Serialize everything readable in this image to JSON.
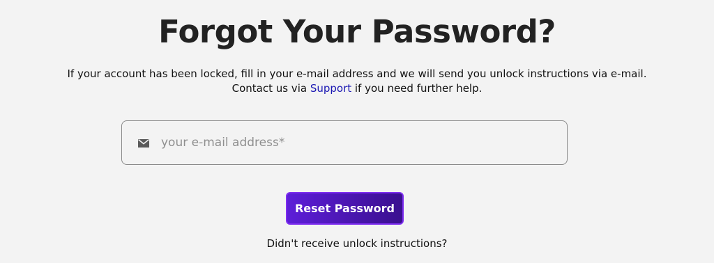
{
  "header": {
    "title": "Forgot Your Password?"
  },
  "description": {
    "line1": "If your account has been locked, fill in your e-mail address and we will send you unlock instructions via e-mail.",
    "line2_prefix": "Contact us via ",
    "support_link": "Support",
    "line2_suffix": " if you need further help."
  },
  "form": {
    "email": {
      "icon": "envelope-icon",
      "placeholder": "your e-mail address*",
      "value": ""
    },
    "submit_label": "Reset Password",
    "resend_link": "Didn't receive unlock instructions?"
  },
  "colors": {
    "background": "#f3f3f3",
    "link": "#1a17b3",
    "button_start": "#5d1ed8",
    "button_end": "#3a0f8f"
  }
}
